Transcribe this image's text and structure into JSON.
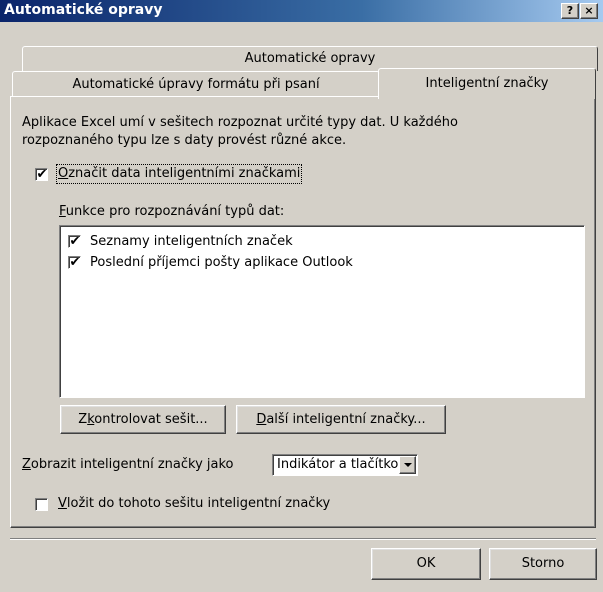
{
  "window": {
    "title": "Automatické opravy",
    "help_glyph": "?",
    "close_glyph": "×"
  },
  "tabs": {
    "back_row": [
      "Automatické opravy"
    ],
    "front_row": [
      "Automatické úpravy formátu při psaní",
      "Inteligentní značky"
    ],
    "active": "Inteligentní značky"
  },
  "description": [
    "Aplikace Excel umí v sešitech rozpoznat určité typy dat. U každého",
    "rozpoznaného typu lze s daty provést různé akce."
  ],
  "label_smart_tags": {
    "underline": "O",
    "rest": "značit data inteligentními značkami",
    "checked": true
  },
  "recognizers": {
    "heading_underline": "F",
    "heading_rest": "unkce pro rozpoznávání typů dat:",
    "items": [
      {
        "label": "Seznamy inteligentních značek",
        "checked": true
      },
      {
        "label": "Poslední příjemci pošty aplikace Outlook",
        "checked": true
      }
    ]
  },
  "buttons": {
    "check_workbook": {
      "pre": "Z",
      "underline": "k",
      "post": "ontrolovat sešit..."
    },
    "more_smart_tags": {
      "underline": "D",
      "post": "alší inteligentní značky..."
    },
    "ok": "OK",
    "cancel": "Storno"
  },
  "show_as": {
    "label_underline": "Z",
    "label_rest": "obrazit inteligentní značky jako",
    "selected": "Indikátor a tlačítko"
  },
  "embed_smart_tags": {
    "underline": "V",
    "rest": "ložit do tohoto sešitu inteligentní značky",
    "checked": false
  },
  "check_glyph": "✔"
}
